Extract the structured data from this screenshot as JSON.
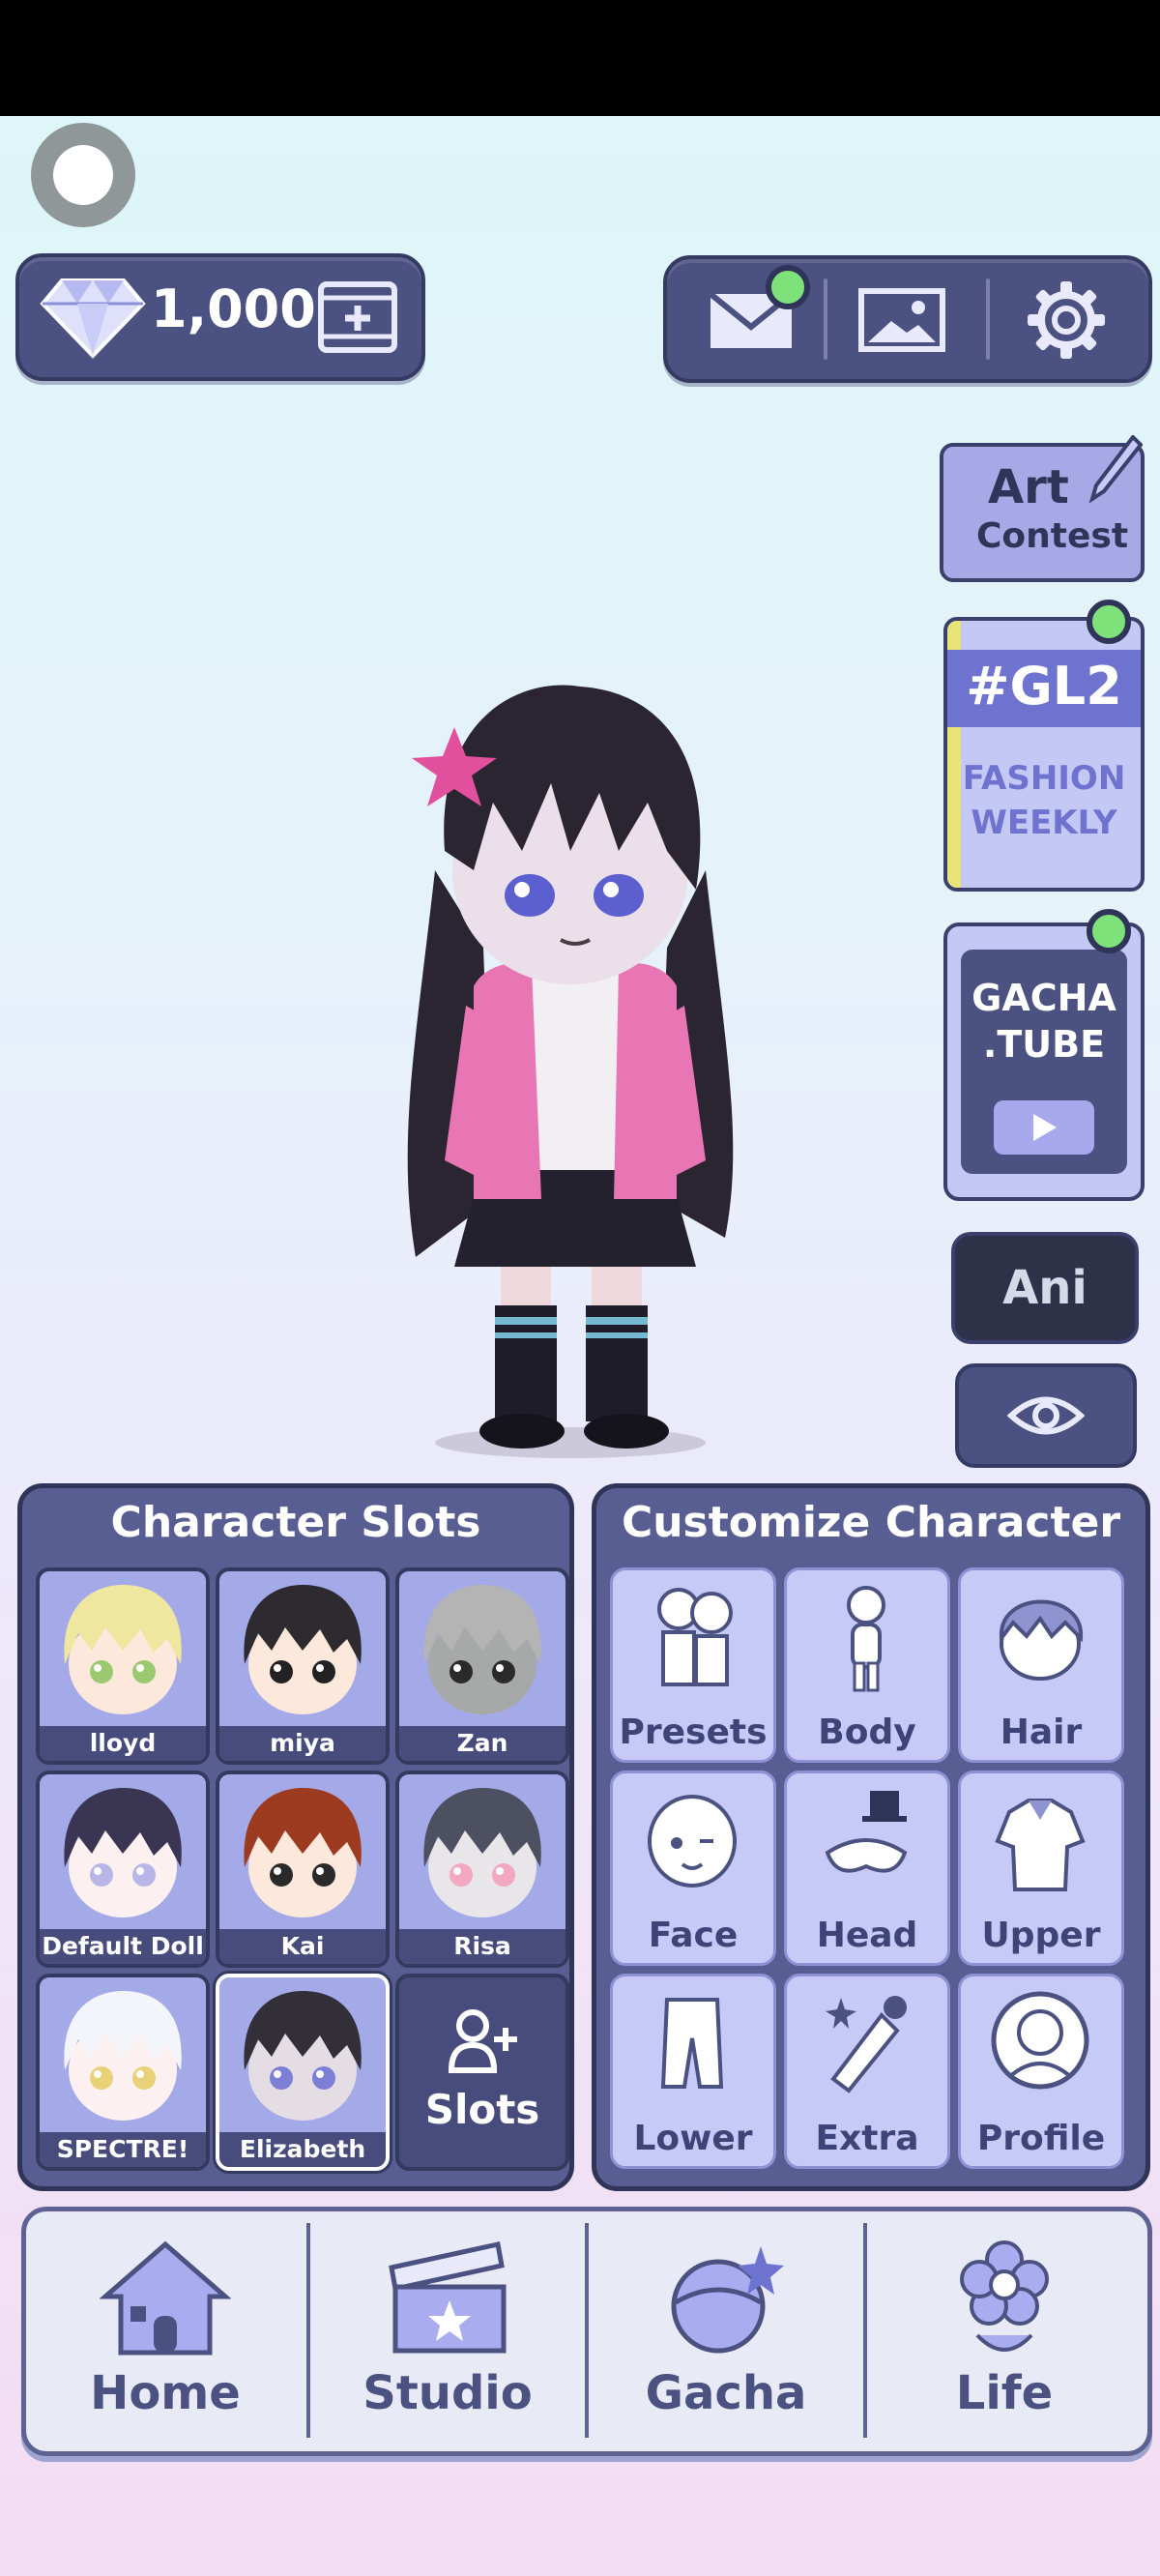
{
  "currency": {
    "amount": "1,000",
    "icon": "diamond-icon",
    "add_icon": "add-gems-video-icon"
  },
  "top_buttons": [
    {
      "name": "mail-button",
      "icon": "mail-icon",
      "has_notification": true
    },
    {
      "name": "gallery-button",
      "icon": "image-icon",
      "has_notification": false
    },
    {
      "name": "settings-button",
      "icon": "gear-icon",
      "has_notification": false
    }
  ],
  "side": {
    "art_contest": {
      "line1": "Art",
      "line2": "Contest"
    },
    "gl2": {
      "title": "#GL2",
      "line1": "FASHION",
      "line2": "WEEKLY"
    },
    "gacha_tube": {
      "line1": "GACHA",
      "line2": ".TUBE"
    },
    "ani_label": "Ani"
  },
  "character_slots": {
    "title": "Character Slots",
    "slots": [
      {
        "name": "lloyd",
        "hair": "#efe6a0",
        "skin": "#fde8dc",
        "eyes": "#9bc96f"
      },
      {
        "name": "miya",
        "hair": "#2d2a30",
        "skin": "#fde8dc",
        "eyes": "#222222"
      },
      {
        "name": "Zan",
        "hair": "#b4b4b4",
        "skin": "#a7a9a9",
        "eyes": "#2a2a2a"
      },
      {
        "name": "Default Doll",
        "hair": "#3a3553",
        "skin": "#fdf0f0",
        "eyes": "#b8b6e6"
      },
      {
        "name": "Kai",
        "hair": "#9c3b1f",
        "skin": "#fde8dc",
        "eyes": "#2a2a2a"
      },
      {
        "name": "Risa",
        "hair": "#4d5060",
        "skin": "#e9e6ea",
        "eyes": "#f1a8c0"
      },
      {
        "name": "SPECTRE!",
        "hair": "#f4f4fb",
        "skin": "#fdf0f0",
        "eyes": "#e8d177"
      },
      {
        "name": "Elizabeth",
        "hair": "#332f38",
        "skin": "#e5dde4",
        "eyes": "#7d7fd6"
      }
    ],
    "selected": "Elizabeth",
    "add_label": "Slots"
  },
  "customize": {
    "title": "Customize Character",
    "items": [
      "Presets",
      "Body",
      "Hair",
      "Face",
      "Head",
      "Upper",
      "Lower",
      "Extra",
      "Profile"
    ]
  },
  "nav": [
    {
      "label": "Home",
      "icon": "house-icon"
    },
    {
      "label": "Studio",
      "icon": "clapperboard-icon"
    },
    {
      "label": "Gacha",
      "icon": "gacha-ball-icon"
    },
    {
      "label": "Life",
      "icon": "flower-icon"
    }
  ]
}
